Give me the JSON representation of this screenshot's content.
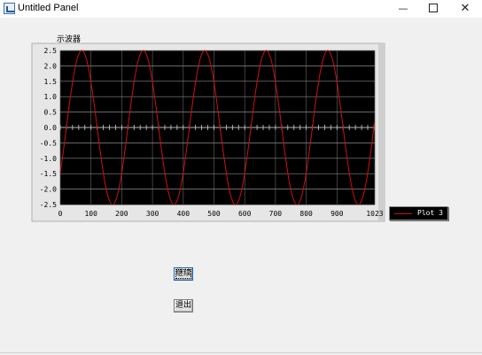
{
  "window": {
    "title": "Untitled Panel",
    "controls": {
      "minimize": "—",
      "close": "✕"
    }
  },
  "graph": {
    "label": "示波器",
    "legend": "Plot 3",
    "plot_bg": "#000000",
    "trace_color": "#d01010"
  },
  "buttons": {
    "continue_label": "继续",
    "exit_label": "退出"
  },
  "chart_data": {
    "type": "line",
    "title": "示波器",
    "xlabel": "",
    "ylabel": "",
    "xlim": [
      0,
      1023
    ],
    "ylim": [
      -2.5,
      2.5
    ],
    "x_ticks": [
      "0",
      "100",
      "200",
      "300",
      "400",
      "500",
      "600",
      "700",
      "800",
      "900",
      "1023"
    ],
    "y_ticks": [
      "2.5",
      "2.0",
      "1.5",
      "1.0",
      "0.5",
      "0.0",
      "-0.5",
      "-1.0",
      "-1.5",
      "-2.0",
      "-2.5"
    ],
    "grid": true,
    "legend_position": "right",
    "series": [
      {
        "name": "Plot 3",
        "function": "sine",
        "amplitude": 2.5,
        "period": 200,
        "phase_offset_x": 20,
        "x_range": [
          0,
          1023
        ]
      }
    ]
  }
}
